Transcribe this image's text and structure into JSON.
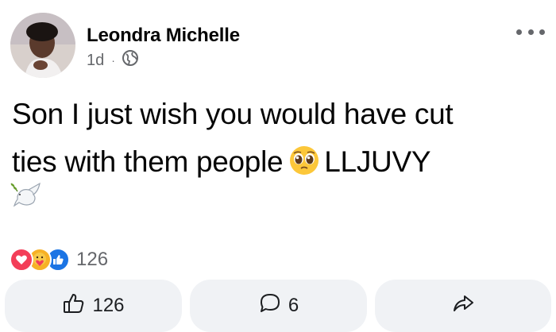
{
  "post": {
    "author": "Leondra Michelle",
    "time": "1d",
    "separator": "·",
    "audience_icon": "globe-icon",
    "text_line1": "Son I just wish you would have cut",
    "text_line2_before": "ties with them people",
    "text_emoji": "pleading-face-emoji",
    "text_line2_after": "LLJUVY",
    "extra_emoji": "dove-emoji"
  },
  "reactions": {
    "types": [
      "love-icon",
      "care-icon",
      "like-icon"
    ],
    "count": "126"
  },
  "actions": {
    "like_count": "126",
    "comment_count": "6"
  },
  "colors": {
    "button_bg": "#f0f2f5",
    "secondary_text": "#65676b",
    "love": "#f33e58",
    "care": "#f7b125",
    "like": "#1b74e4"
  }
}
